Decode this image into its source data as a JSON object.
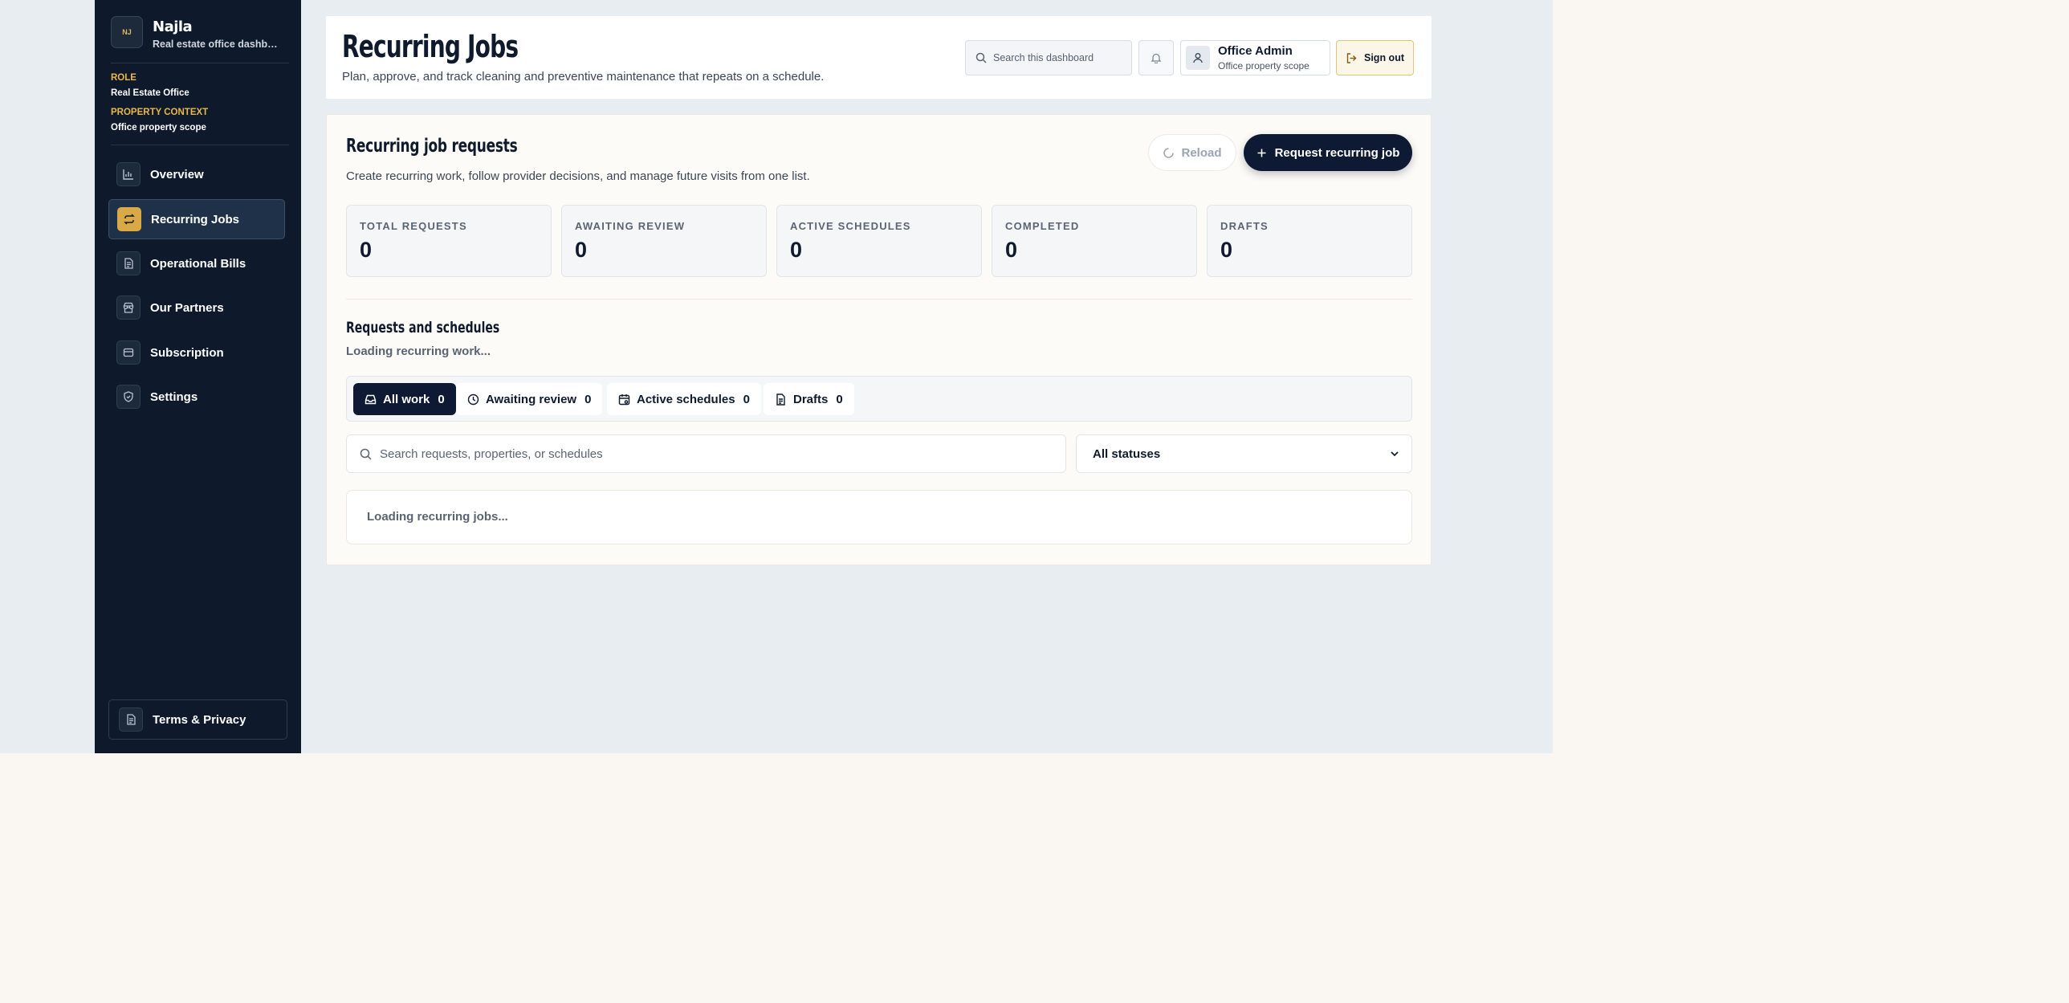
{
  "brand": {
    "logo_text": "NJ",
    "name": "Najla",
    "subtitle": "Real estate office dashboard"
  },
  "context": {
    "role_label": "ROLE",
    "role_value": "Real Estate Office",
    "property_label": "PROPERTY CONTEXT",
    "property_value": "Office property scope"
  },
  "nav": {
    "items": [
      {
        "label": "Overview",
        "icon": "bar-chart-icon",
        "active": false
      },
      {
        "label": "Recurring Jobs",
        "icon": "repeat-icon",
        "active": true
      },
      {
        "label": "Operational Bills",
        "icon": "file-text-icon",
        "active": false
      },
      {
        "label": "Our Partners",
        "icon": "store-icon",
        "active": false
      },
      {
        "label": "Subscription",
        "icon": "card-icon",
        "active": false
      },
      {
        "label": "Settings",
        "icon": "shield-icon",
        "active": false
      }
    ],
    "footer_label": "Terms & Privacy"
  },
  "header": {
    "title": "Recurring Jobs",
    "subtitle": "Plan, approve, and track cleaning and preventive maintenance that repeats on a schedule.",
    "search_placeholder": "Search this dashboard",
    "user_name": "Office Admin",
    "user_scope": "Office property scope",
    "signout_label": "Sign out"
  },
  "main": {
    "title": "Recurring job requests",
    "subtitle": "Create recurring work, follow provider decisions, and manage future visits from one list.",
    "reload_label": "Reload",
    "request_label": "Request recurring job",
    "stats": [
      {
        "label": "TOTAL REQUESTS",
        "value": "0"
      },
      {
        "label": "AWAITING REVIEW",
        "value": "0"
      },
      {
        "label": "ACTIVE SCHEDULES",
        "value": "0"
      },
      {
        "label": "COMPLETED",
        "value": "0"
      },
      {
        "label": "DRAFTS",
        "value": "0"
      }
    ],
    "list_title": "Requests and schedules",
    "list_status": "Loading recurring work...",
    "tabs": [
      {
        "label": "All work",
        "count": "0",
        "active": true
      },
      {
        "label": "Awaiting review",
        "count": "0",
        "active": false
      },
      {
        "label": "Active schedules",
        "count": "0",
        "active": false
      },
      {
        "label": "Drafts",
        "count": "0",
        "active": false
      }
    ],
    "search_placeholder": "Search requests, properties, or schedules",
    "status_filter": "All statuses",
    "empty_message": "Loading recurring jobs..."
  },
  "colors": {
    "sidebar_bg": "#0e1a2b",
    "accent_gold": "#d9a948",
    "primary_navy": "#0e1a33",
    "page_bg": "#e8edf1"
  }
}
